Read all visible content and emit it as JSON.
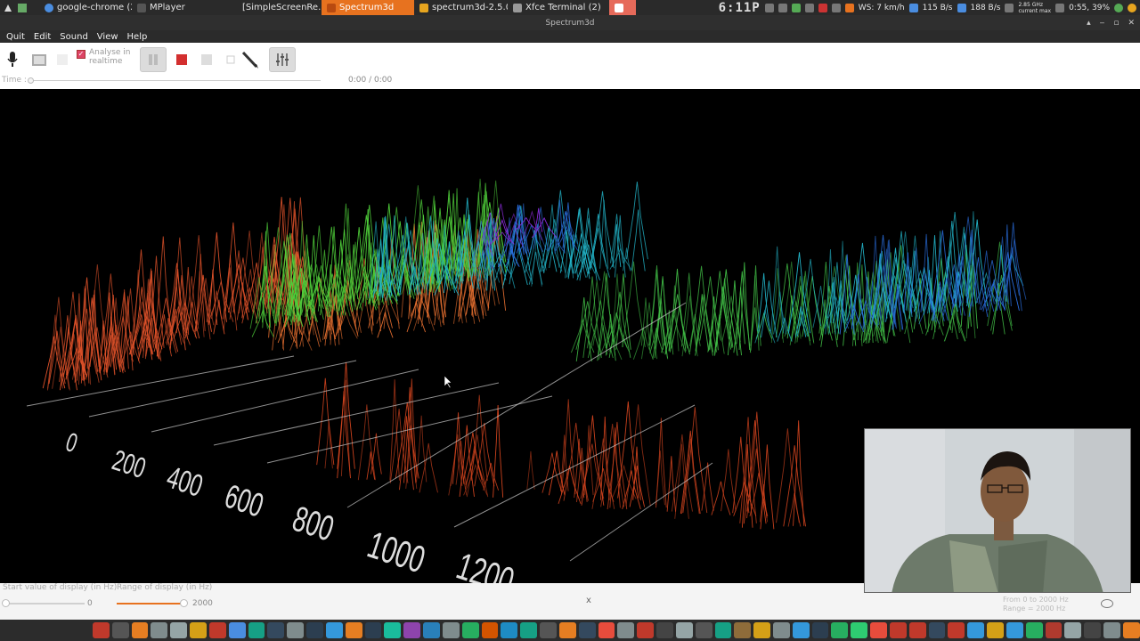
{
  "top_panel": {
    "tasks": [
      {
        "label": "google-chrome (2)",
        "icon": "chrome-icon",
        "color": "#4a8de0",
        "active": false
      },
      {
        "label": "MPlayer",
        "icon": "mplayer-icon",
        "color": "#555555",
        "active": false
      },
      {
        "label": "[SimpleScreenRe...",
        "icon": "recorder-icon",
        "color": "#333333",
        "active": false
      },
      {
        "label": "Spectrum3d",
        "icon": "spectrum-icon",
        "color": "#e7721f",
        "active": true
      },
      {
        "label": "spectrum3d-2.5.0...",
        "icon": "archive-icon",
        "color": "#e7a51f",
        "active": false
      },
      {
        "label": "Xfce Terminal (2)",
        "icon": "terminal-icon",
        "color": "#999999",
        "active": false
      }
    ],
    "clock": "6:11P",
    "weather": "WS: 7 km/h",
    "net_down": "115 B/s",
    "net_up": "188 B/s",
    "cpu_freq": "2.85 GHz",
    "cpu_freq_label": "current max",
    "battery": "0:55, 39%"
  },
  "window": {
    "title": "Spectrum3d"
  },
  "menubar": {
    "items": [
      "Quit",
      "Edit",
      "Sound",
      "View",
      "Help"
    ]
  },
  "toolbar": {
    "analyse_label": "Analyse in realtime",
    "time_label": "Time :",
    "time_value": "0:00 / 0:00",
    "time_progress": 0
  },
  "viz": {
    "axis_ticks": [
      "0",
      "200",
      "400",
      "600",
      "800",
      "1000",
      "1200"
    ]
  },
  "bottom": {
    "start_label": "Start value of display (in Hz)",
    "range_label": "Range of display (in Hz)",
    "start_value": "0",
    "range_value": "2000",
    "range_fraction": 1.0,
    "close_x": "x",
    "info_line1": "From 0 to 2000 Hz",
    "info_line2": "Range = 2000 Hz"
  },
  "colors": {
    "accent": "#e7721f",
    "warm": "#e0522a",
    "green": "#4fcf3a",
    "cyan": "#22b4c8",
    "blue": "#2a6fe0",
    "purple": "#8a2ad8"
  },
  "dock": {
    "icons": [
      "adobe-reader-icon",
      "terminal-icon",
      "firefox-icon",
      "files-icon",
      "folder-icon",
      "document-icon",
      "red-app-icon",
      "chrome-icon",
      "arduino-icon",
      "hexchat-icon",
      "notes-icon",
      "media-icon",
      "bluetooth-icon",
      "blender-icon",
      "inkscape-icon",
      "network-icon",
      "gimp-icon",
      "photo-icon",
      "settings-icon",
      "calculator-icon",
      "editor-icon",
      "texmaker-icon",
      "audio-icon",
      "launcher-icon",
      "firefox-alt-icon",
      "hexchat-alt-icon",
      "messaging-icon",
      "library-icon",
      "pocket-icon",
      "camera-icon",
      "radio-icon",
      "chat-icon",
      "terminal-alt-icon",
      "archive-icon",
      "folder-alt-icon",
      "shield-icon",
      "download-icon",
      "steam-icon",
      "network-alt-icon",
      "folder-green-icon",
      "android-icon",
      "filezilla-icon",
      "opera-icon",
      "hash-icon",
      "bittorrent-icon",
      "skype-icon",
      "printer-icon",
      "file-icon",
      "terminal-green-icon",
      "wine-icon",
      "keyring-icon",
      "monitor-icon",
      "system-icon",
      "vlc-icon"
    ]
  }
}
